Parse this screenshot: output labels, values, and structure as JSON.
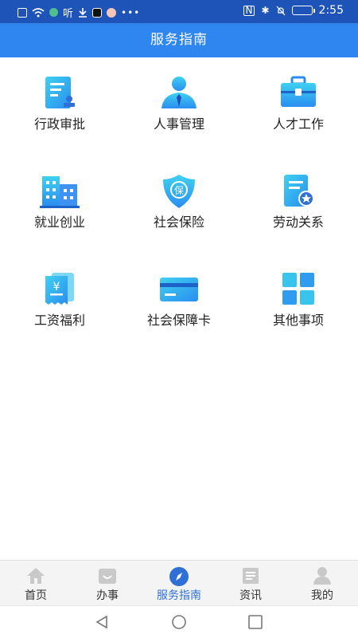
{
  "status_bar": {
    "time": "2:55",
    "carrier_text": "听"
  },
  "header": {
    "title": "服务指南"
  },
  "services": [
    {
      "label": "行政审批",
      "icon": "document-stamp-icon"
    },
    {
      "label": "人事管理",
      "icon": "person-tie-icon"
    },
    {
      "label": "人才工作",
      "icon": "briefcase-icon"
    },
    {
      "label": "就业创业",
      "icon": "buildings-icon"
    },
    {
      "label": "社会保险",
      "icon": "shield-bao-icon"
    },
    {
      "label": "劳动关系",
      "icon": "certificate-star-icon"
    },
    {
      "label": "工资福利",
      "icon": "yuan-receipt-icon"
    },
    {
      "label": "社会保障卡",
      "icon": "card-icon"
    },
    {
      "label": "其他事项",
      "icon": "grid-icon"
    }
  ],
  "tabbar": {
    "items": [
      {
        "label": "首页",
        "icon": "home-icon"
      },
      {
        "label": "办事",
        "icon": "service-icon"
      },
      {
        "label": "服务指南",
        "icon": "compass-icon",
        "active": true
      },
      {
        "label": "资讯",
        "icon": "news-icon"
      },
      {
        "label": "我的",
        "icon": "user-icon"
      }
    ]
  },
  "colors": {
    "header": "#2f86f0",
    "status": "#1e54b8",
    "accent": "#2f6fd6",
    "icon_cyan": "#25c6e6"
  }
}
